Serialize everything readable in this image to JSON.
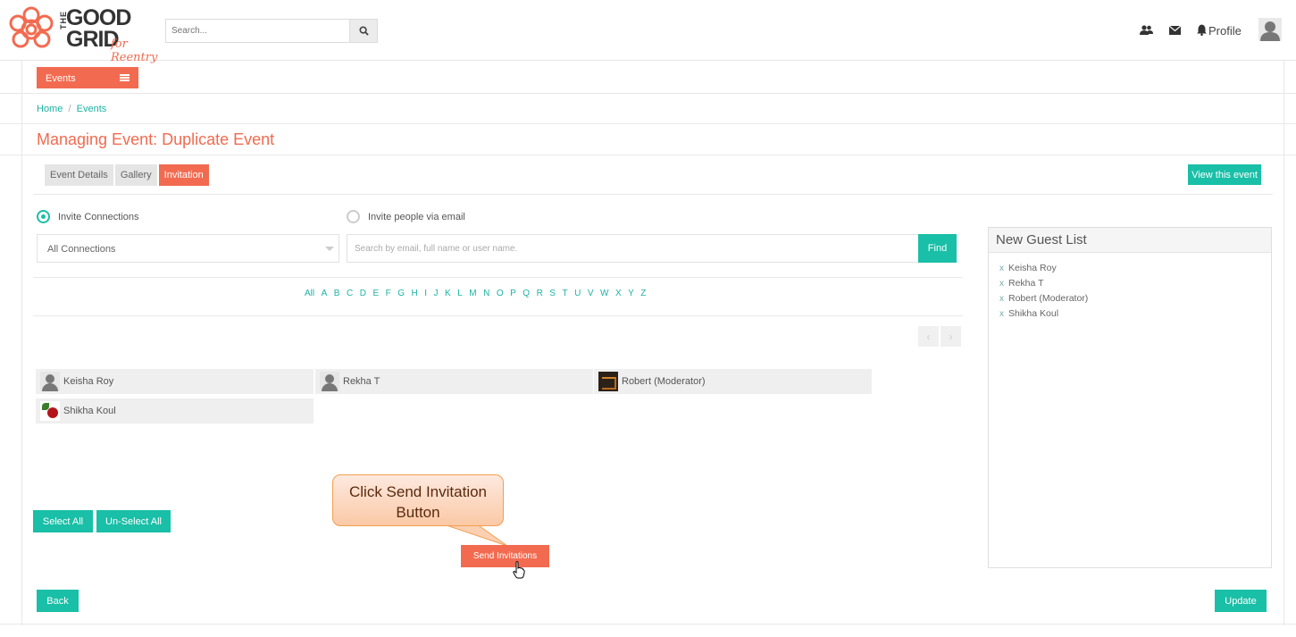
{
  "brand": {
    "word1": "GOOD",
    "word2": "GRID",
    "the": "THE",
    "tagline": "for Reentry"
  },
  "search": {
    "placeholder": "Search..."
  },
  "nav": {
    "profile_label": "Profile"
  },
  "events_menu": {
    "label": "Events"
  },
  "breadcrumb": {
    "home": "Home",
    "sep": "/",
    "current": "Events"
  },
  "page": {
    "title": "Managing Event: Duplicate Event"
  },
  "tabs": [
    {
      "label": "Event Details",
      "active": false
    },
    {
      "label": "Gallery",
      "active": false
    },
    {
      "label": "Invitation",
      "active": true
    }
  ],
  "view_event_label": "View this event",
  "invite": {
    "option_connections": "Invite Connections",
    "option_email": "Invite people via email",
    "selected": "connections",
    "select_value": "All Connections",
    "find_placeholder": "Search by email, full name or user name.",
    "find_label": "Find"
  },
  "alphabet": [
    "All",
    "A",
    "B",
    "C",
    "D",
    "E",
    "F",
    "G",
    "H",
    "I",
    "J",
    "K",
    "L",
    "M",
    "N",
    "O",
    "P",
    "Q",
    "R",
    "S",
    "T",
    "U",
    "V",
    "W",
    "X",
    "Y",
    "Z"
  ],
  "people": [
    {
      "name": "Keisha Roy",
      "avatar": "generic"
    },
    {
      "name": "Rekha T",
      "avatar": "generic"
    },
    {
      "name": "Robert (Moderator)",
      "avatar": "dark"
    },
    {
      "name": "Shikha Koul",
      "avatar": "rose"
    }
  ],
  "buttons": {
    "select_all": "Select All",
    "unselect_all": "Un-Select All",
    "send": "Send Invitations",
    "back": "Back",
    "update": "Update"
  },
  "guest_list": {
    "title": "New Guest List",
    "remove_glyph": "x",
    "items": [
      "Keisha Roy",
      "Rekha T",
      "Robert (Moderator)",
      "Shikha Koul"
    ]
  },
  "callout": {
    "line1": "Click Send Invitation",
    "line2": "Button"
  },
  "colors": {
    "accent": "#f26b50",
    "teal": "#19bfa7"
  }
}
